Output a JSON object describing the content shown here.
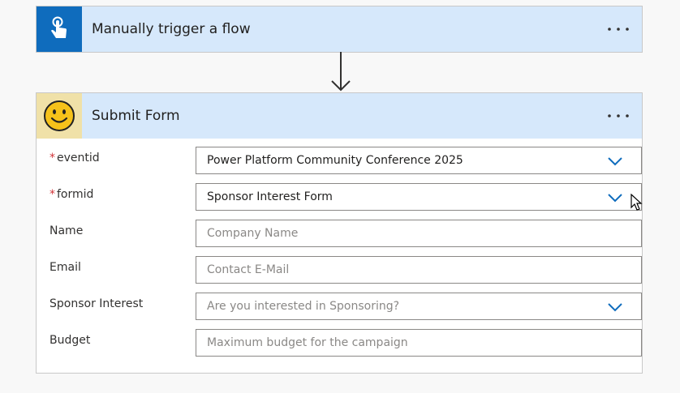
{
  "trigger": {
    "title": "Manually trigger a flow",
    "icon": "touch-icon"
  },
  "action": {
    "title": "Submit Form",
    "icon": "smiley-icon",
    "fields": [
      {
        "label": "eventid",
        "required": true,
        "value": "Power Platform Community Conference 2025",
        "placeholder": "",
        "type": "dropdown"
      },
      {
        "label": "formid",
        "required": true,
        "value": "Sponsor Interest Form",
        "placeholder": "",
        "type": "dropdown"
      },
      {
        "label": "Name",
        "required": false,
        "value": "",
        "placeholder": "Company Name",
        "type": "text"
      },
      {
        "label": "Email",
        "required": false,
        "value": "",
        "placeholder": "Contact E-Mail",
        "type": "text"
      },
      {
        "label": "Sponsor Interest",
        "required": false,
        "value": "",
        "placeholder": "Are you interested in Sponsoring?",
        "type": "dropdown"
      },
      {
        "label": "Budget",
        "required": false,
        "value": "",
        "placeholder": "Maximum budget for the campaign",
        "type": "text"
      }
    ]
  },
  "colors": {
    "accent": "#0f6cbd",
    "header_bg": "#d6e8fb",
    "required": "#d13438"
  }
}
